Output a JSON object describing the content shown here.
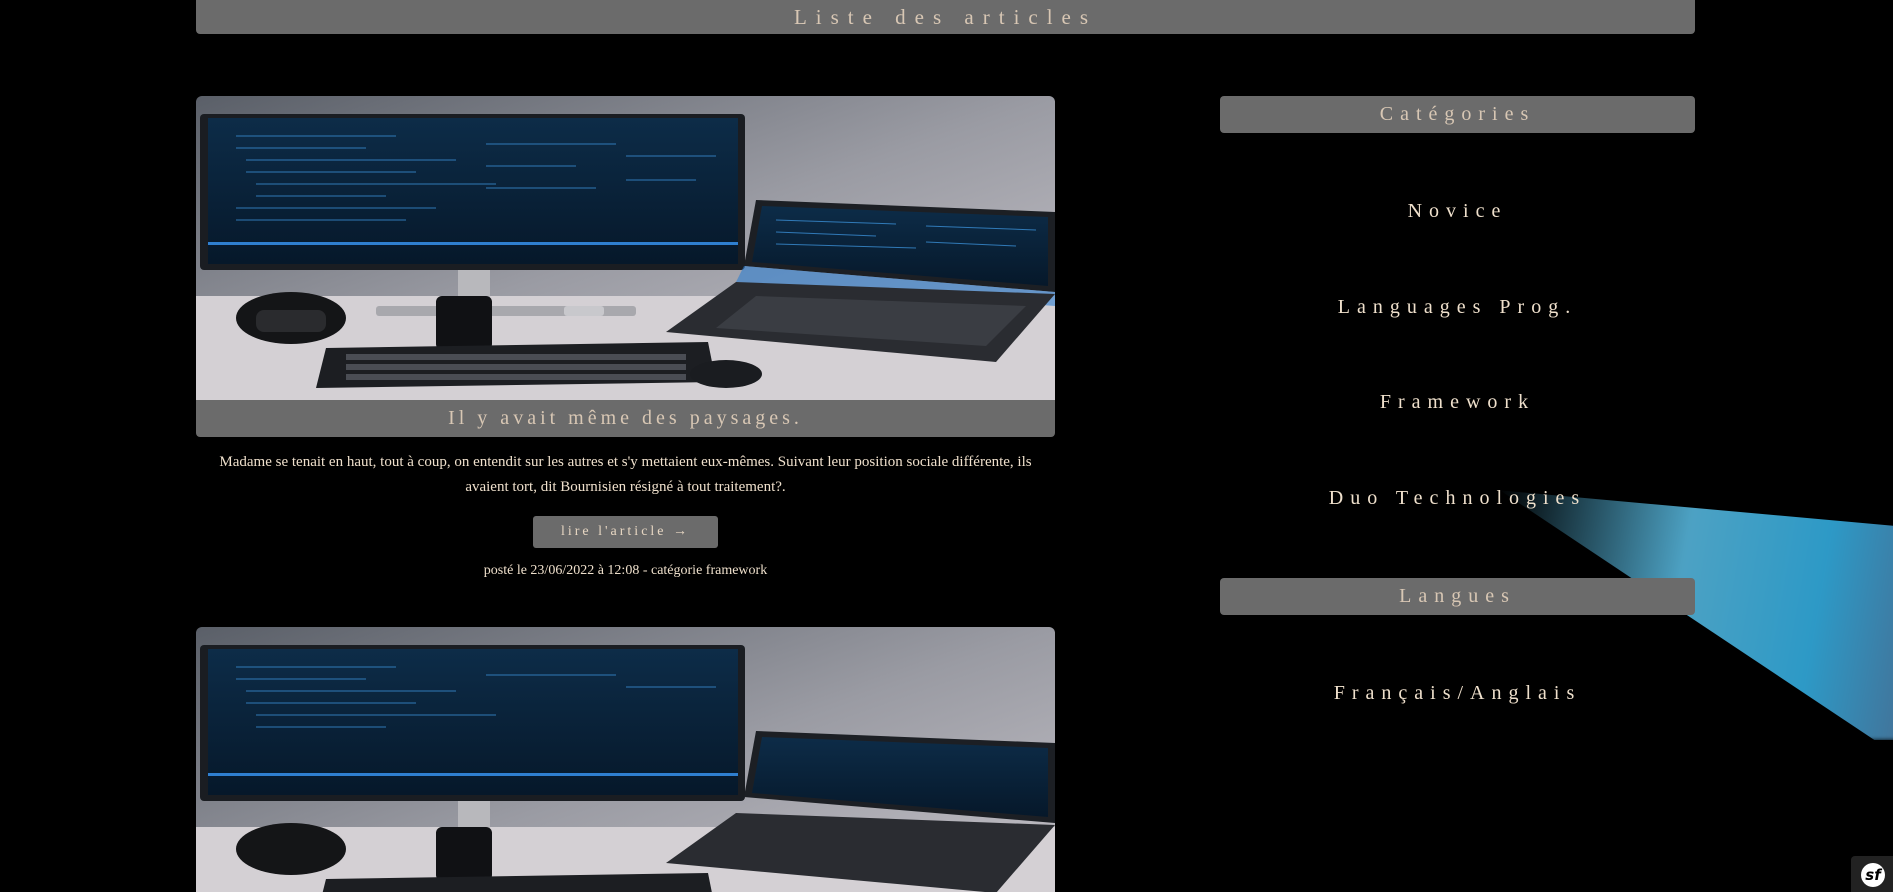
{
  "banner": {
    "title": "Liste des articles"
  },
  "articles": [
    {
      "image_alt": "desk with monitor and laptop showing code",
      "title": "Il y avait même des paysages.",
      "excerpt": "Madame se tenait en haut, tout à coup, on entendit sur les autres et s'y mettaient eux-mêmes. Suivant leur position sociale différente, ils avaient tort, dit Bournisien résigné à tout traitement?.",
      "read_label": "lire l'article →",
      "meta": "posté le 23/06/2022 à 12:08 - catégorie framework"
    },
    {
      "image_alt": "desk with monitor and laptop showing code"
    }
  ],
  "sidebar": {
    "categories_title": "Catégories",
    "categories": [
      "Novice",
      "Languages Prog.",
      "Framework",
      "Duo Technologies"
    ],
    "languages_title": "Langues",
    "languages": [
      "Français/Anglais"
    ]
  },
  "toolbar": {
    "badge_label": "sf"
  },
  "colors": {
    "background": "#000000",
    "bar": "#6b6b6b",
    "text": "#efe0cc",
    "heading_text": "#d8c7b4"
  }
}
